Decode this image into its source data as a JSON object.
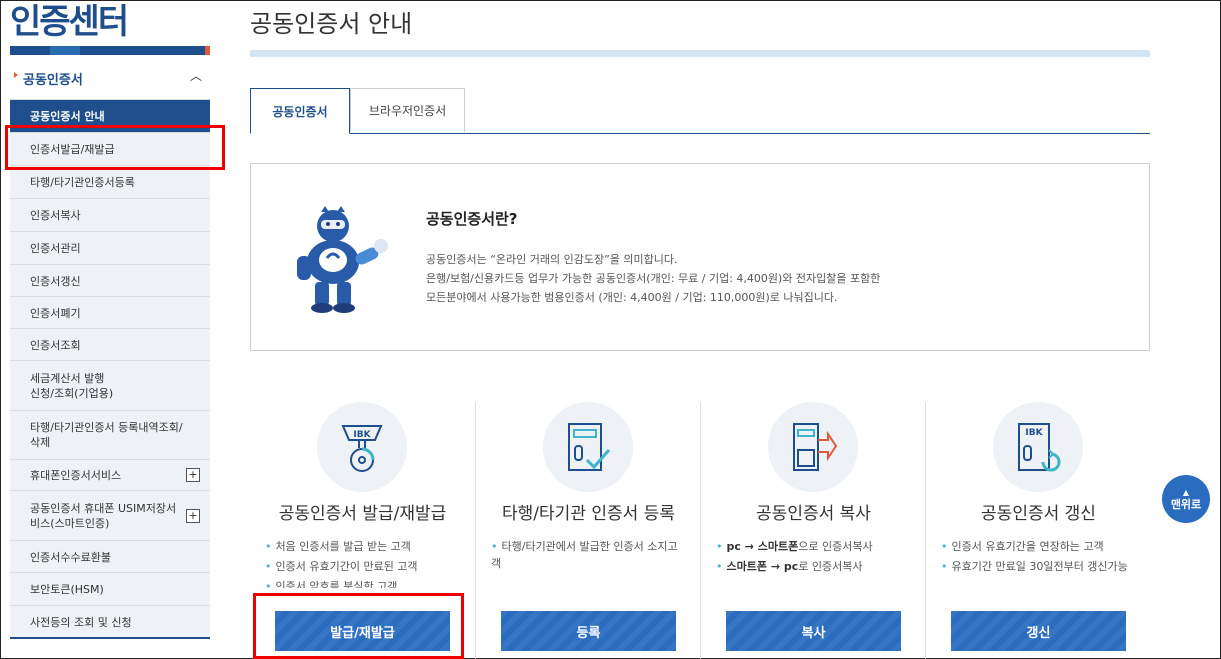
{
  "sidebar": {
    "title": "인증센터",
    "group_label": "공동인증서",
    "items": [
      {
        "label": "공동인증서 안내"
      },
      {
        "label": "인증서발급/재발급"
      },
      {
        "label": "타행/타기관인증서등록"
      },
      {
        "label": "인증서복사"
      },
      {
        "label": "인증서관리"
      },
      {
        "label": "인증서갱신"
      },
      {
        "label": "인증서폐기"
      },
      {
        "label": "인증서조회"
      },
      {
        "label": "세금계산서 발행\n신청/조회(기업용)"
      },
      {
        "label": "타행/타기관인증서 등록내역조회/삭제"
      },
      {
        "label": "휴대폰인증서서비스"
      },
      {
        "label": "공동인증서 휴대폰 USIM저장서비스(스마트인증)"
      },
      {
        "label": "인증서수수료환불"
      },
      {
        "label": "보안토큰(HSM)"
      },
      {
        "label": "사전등의 조회 및 신청"
      }
    ]
  },
  "main": {
    "page_title": "공동인증서 안내",
    "tabs": [
      {
        "label": "공동인증서"
      },
      {
        "label": "브라우저인증서"
      }
    ],
    "info": {
      "heading": "공동인증서란?",
      "line1": "공동인증서는 “온라인 거래의 인감도장”을 의미합니다.",
      "line2": "은행/보험/신용카드등 업무가 가능한 공동인증서(개인: 무료 / 기업: 4,400원)와 전자입찰을 포함한",
      "line3": "모든분야에서 사용가능한 범용인증서 (개인: 4,400원 / 기업: 110,000원)로 나눠집니다."
    },
    "cards": [
      {
        "icon": "certificate-issue-icon",
        "title": "공동인증서 발급/재발급",
        "bullets": [
          "처음 인증서를 발급 받는 고객",
          "인증서 유효기간이 만료된 고객",
          "인증서 암호를 분실한 고객"
        ],
        "button": "발급/재발급"
      },
      {
        "icon": "register-check-icon",
        "title": "타행/타기관 인증서 등록",
        "bullets": [
          "타행/타기관에서 발급한 인증서 소지고객"
        ],
        "button": "등록"
      },
      {
        "icon": "copy-transfer-icon",
        "title": "공동인증서 복사",
        "bullets_rich": [
          {
            "a": "pc",
            "arrow": " → ",
            "b": "스마트폰",
            "rest": "으로 인증서복사"
          },
          {
            "a": "스마트폰",
            "arrow": " → ",
            "b": "pc",
            "rest": "로 인증서복사"
          }
        ],
        "button": "복사"
      },
      {
        "icon": "renew-icon",
        "title": "공동인증서 갱신",
        "bullets": [
          "인증서 유효기간을 연장하는 고객",
          "유효기간 만료일 30일전부터 갱신가능"
        ],
        "button": "갱신"
      }
    ],
    "top_button": "맨위로",
    "ibk_text": "IBK"
  },
  "colors": {
    "brand": "#1f4e8c",
    "button": "#2a6cc0",
    "highlight": "#e00000"
  }
}
